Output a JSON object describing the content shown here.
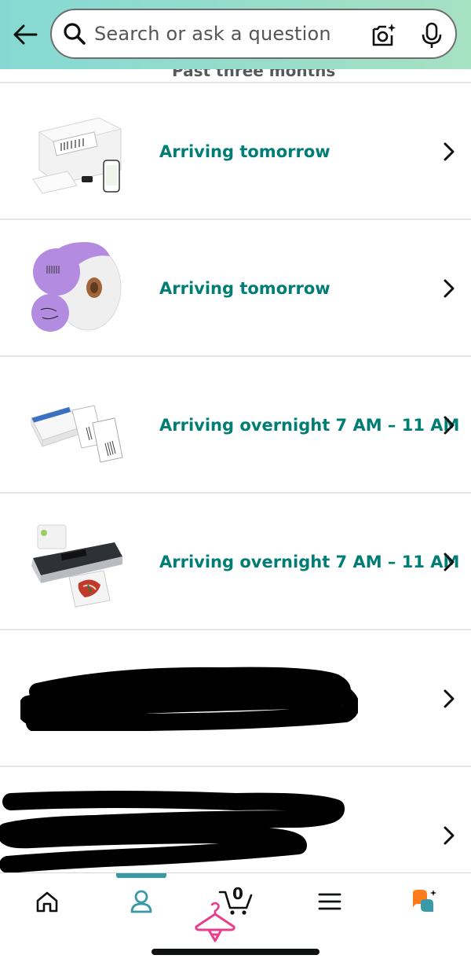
{
  "header": {
    "search_placeholder": "Search or ask a question"
  },
  "section": {
    "title": "Past three months"
  },
  "orders": [
    {
      "status": "Arriving tomorrow",
      "thumbnail": "label-printer-product"
    },
    {
      "status": "Arriving tomorrow",
      "thumbnail": "purple-label-roll-product"
    },
    {
      "status": "Arriving overnight 7 AM – 11 AM",
      "thumbnail": "shipping-labels-product"
    },
    {
      "status": "Arriving overnight 7 AM – 11 AM",
      "thumbnail": "vacuum-sealer-product"
    },
    {
      "status": "",
      "thumbnail": "redacted"
    },
    {
      "status": "",
      "thumbnail": "redacted"
    }
  ],
  "bottom_nav": {
    "items": [
      "home-icon",
      "account-icon",
      "cart-icon",
      "menu-icon",
      "rufus-icon"
    ],
    "cart_count": "0",
    "active": "account-icon"
  },
  "colors": {
    "accent": "#007d75",
    "header_start": "#86d9d3",
    "header_end": "#a6e1c2",
    "nav_active": "#3a99a6",
    "promo_pink": "#e83e8c"
  }
}
